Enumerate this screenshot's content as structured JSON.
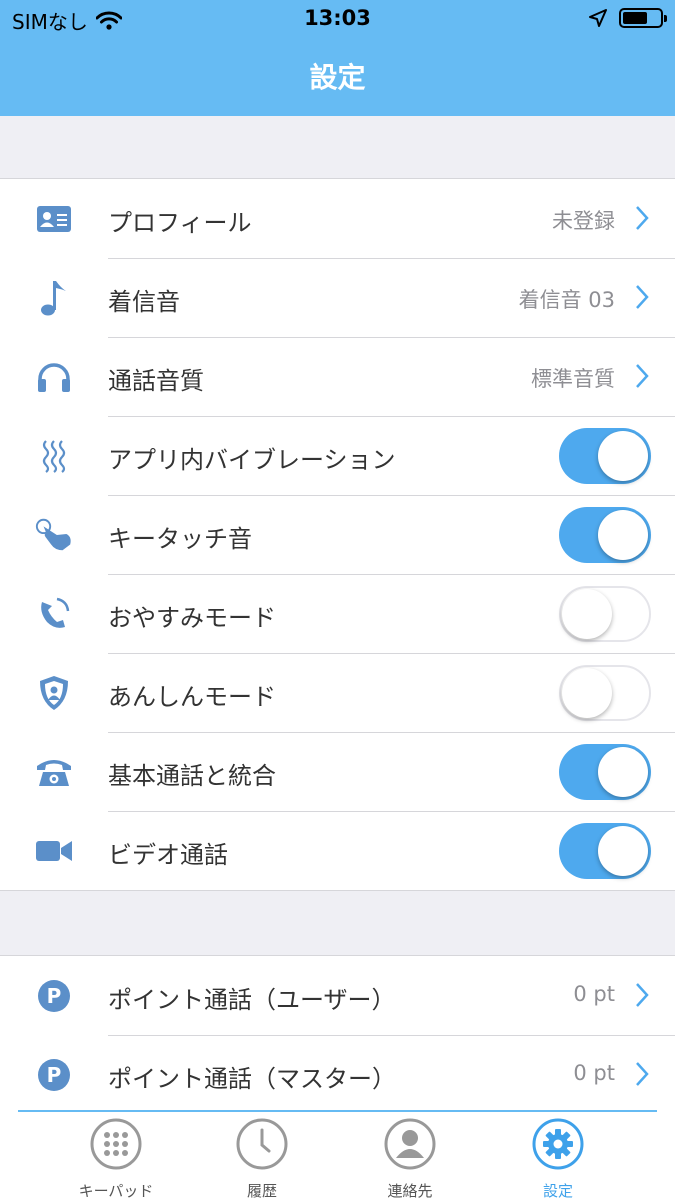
{
  "status_bar": {
    "carrier": "SIMなし",
    "time": "13:03"
  },
  "nav": {
    "title": "設定"
  },
  "settings_group_1": [
    {
      "label": "プロフィール",
      "value": "未登録",
      "type": "link",
      "icon": "profile-card-icon"
    },
    {
      "label": "着信音",
      "value": "着信音 03",
      "type": "link",
      "icon": "music-note-icon"
    },
    {
      "label": "通話音質",
      "value": "標準音質",
      "type": "link",
      "icon": "headphones-icon"
    },
    {
      "label": "アプリ内バイブレーション",
      "type": "toggle",
      "on": true,
      "icon": "vibration-icon"
    },
    {
      "label": "キータッチ音",
      "type": "toggle",
      "on": true,
      "icon": "key-touch-icon"
    },
    {
      "label": "おやすみモード",
      "type": "toggle",
      "on": false,
      "icon": "sleep-phone-icon"
    },
    {
      "label": "あんしんモード",
      "type": "toggle",
      "on": false,
      "icon": "shield-user-icon"
    },
    {
      "label": "基本通話と統合",
      "type": "toggle",
      "on": true,
      "icon": "telephone-icon"
    },
    {
      "label": "ビデオ通話",
      "type": "toggle",
      "on": true,
      "icon": "video-camera-icon"
    }
  ],
  "settings_group_2": [
    {
      "label": "ポイント通話（ユーザー）",
      "value": "0 pt",
      "type": "link",
      "icon": "points-p-icon"
    },
    {
      "label": "ポイント通話（マスター）",
      "value": "0 pt",
      "type": "link",
      "icon": "points-p-icon"
    }
  ],
  "tabs": [
    {
      "label": "キーパッド",
      "icon": "keypad-icon",
      "active": false
    },
    {
      "label": "履歴",
      "icon": "history-clock-icon",
      "active": false
    },
    {
      "label": "連絡先",
      "icon": "contacts-icon",
      "active": false
    },
    {
      "label": "設定",
      "icon": "settings-gear-icon",
      "active": true
    }
  ],
  "colors": {
    "accent": "#66bbf3",
    "toggle_on": "#4ea9ee",
    "icon": "#5b8fc9"
  }
}
